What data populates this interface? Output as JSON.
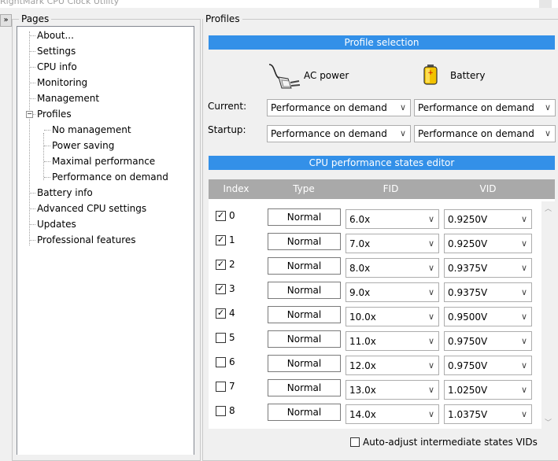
{
  "window": {
    "title": "RightMark CPU Clock Utility"
  },
  "pages": {
    "label": "Pages",
    "items": [
      {
        "label": "About...",
        "level": 0
      },
      {
        "label": "Settings",
        "level": 0
      },
      {
        "label": "CPU info",
        "level": 0
      },
      {
        "label": "Monitoring",
        "level": 0
      },
      {
        "label": "Management",
        "level": 0
      },
      {
        "label": "Profiles",
        "level": 0,
        "expanded": true
      },
      {
        "label": "No management",
        "level": 1
      },
      {
        "label": "Power saving",
        "level": 1
      },
      {
        "label": "Maximal performance",
        "level": 1
      },
      {
        "label": "Performance on demand",
        "level": 1
      },
      {
        "label": "Battery info",
        "level": 0
      },
      {
        "label": "Advanced CPU settings",
        "level": 0
      },
      {
        "label": "Updates",
        "level": 0
      },
      {
        "label": "Professional features",
        "level": 0
      }
    ]
  },
  "profiles": {
    "label": "Profiles",
    "selection_banner": "Profile selection",
    "ac_label": "AC power",
    "battery_label": "Battery",
    "current_label": "Current:",
    "startup_label": "Startup:",
    "current_ac": "Performance on demand",
    "current_battery": "Performance on demand",
    "startup_ac": "Performance on demand",
    "startup_battery": "Performance on demand",
    "editor_banner": "CPU performance states editor",
    "columns": [
      "Index",
      "Type",
      "FID",
      "VID"
    ],
    "auto_adjust_label": "Auto-adjust intermediate states VIDs",
    "auto_adjust_checked": false
  },
  "states": [
    {
      "index": "0",
      "checked": true,
      "type": "Normal",
      "fid": "6.0x",
      "vid": "0.9250V"
    },
    {
      "index": "1",
      "checked": true,
      "type": "Normal",
      "fid": "7.0x",
      "vid": "0.9250V"
    },
    {
      "index": "2",
      "checked": true,
      "type": "Normal",
      "fid": "8.0x",
      "vid": "0.9375V"
    },
    {
      "index": "3",
      "checked": true,
      "type": "Normal",
      "fid": "9.0x",
      "vid": "0.9375V"
    },
    {
      "index": "4",
      "checked": true,
      "type": "Normal",
      "fid": "10.0x",
      "vid": "0.9500V"
    },
    {
      "index": "5",
      "checked": false,
      "type": "Normal",
      "fid": "11.0x",
      "vid": "0.9750V"
    },
    {
      "index": "6",
      "checked": false,
      "type": "Normal",
      "fid": "12.0x",
      "vid": "0.9750V"
    },
    {
      "index": "7",
      "checked": false,
      "type": "Normal",
      "fid": "13.0x",
      "vid": "1.0250V"
    },
    {
      "index": "8",
      "checked": false,
      "type": "Normal",
      "fid": "14.0x",
      "vid": "1.0375V"
    }
  ],
  "icons": {
    "ac_power": "power-plug-icon",
    "battery": "battery-icon",
    "dropdown": "chevron-down-icon",
    "collapse": "collapse-arrow-icon"
  },
  "colors": {
    "banner": "#3390e8",
    "grid_header": "#a9a9a9"
  }
}
